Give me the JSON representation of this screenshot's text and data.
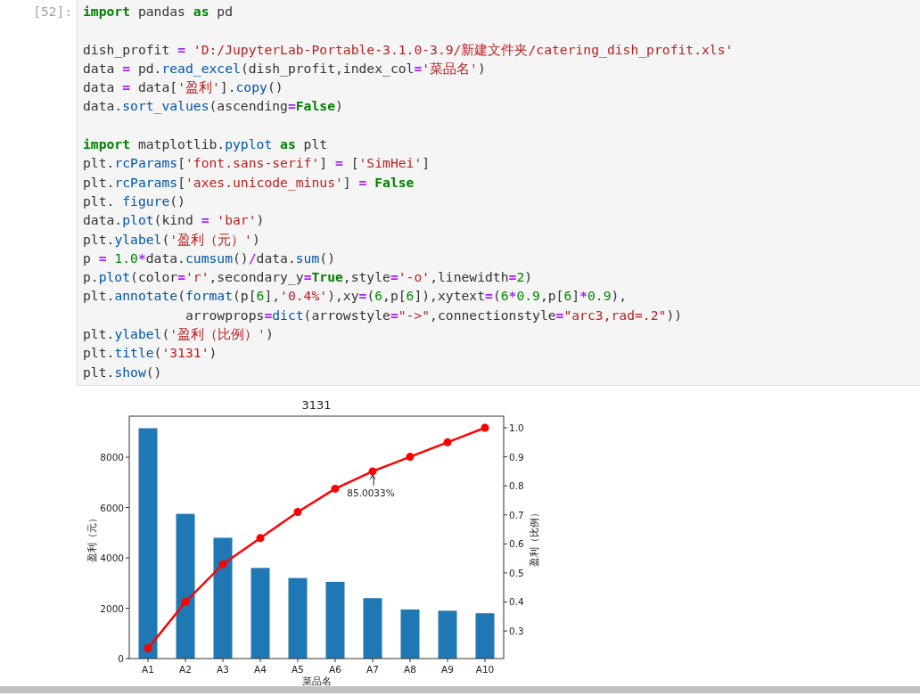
{
  "cell": {
    "prompt": "[52]:",
    "lines": [
      {
        "kind": "code",
        "tokens": [
          {
            "kind": "kw",
            "text": "import"
          },
          {
            "kind": "plain",
            "text": " pandas "
          },
          {
            "kind": "kw",
            "text": "as"
          },
          {
            "kind": "plain",
            "text": " pd"
          }
        ]
      },
      {
        "kind": "blank"
      },
      {
        "kind": "code",
        "tokens": [
          {
            "kind": "plain",
            "text": "dish_profit "
          },
          {
            "kind": "op",
            "text": "= "
          },
          {
            "kind": "str",
            "text": "'D:/JupyterLab-Portable-3.1.0-3.9/新建文件夹/catering_dish_profit.xls'"
          }
        ]
      },
      {
        "kind": "code",
        "tokens": [
          {
            "kind": "plain",
            "text": "data "
          },
          {
            "kind": "op",
            "text": "="
          },
          {
            "kind": "plain",
            "text": " pd."
          },
          {
            "kind": "fn",
            "text": "read_excel"
          },
          {
            "kind": "plain",
            "text": "(dish_profit,index_col"
          },
          {
            "kind": "op",
            "text": "="
          },
          {
            "kind": "str",
            "text": "'菜品名'"
          },
          {
            "kind": "plain",
            "text": ")"
          }
        ]
      },
      {
        "kind": "code",
        "tokens": [
          {
            "kind": "plain",
            "text": "data "
          },
          {
            "kind": "op",
            "text": "="
          },
          {
            "kind": "plain",
            "text": " data["
          },
          {
            "kind": "str",
            "text": "'盈利'"
          },
          {
            "kind": "plain",
            "text": "]."
          },
          {
            "kind": "fn",
            "text": "copy"
          },
          {
            "kind": "plain",
            "text": "()"
          }
        ]
      },
      {
        "kind": "code",
        "tokens": [
          {
            "kind": "plain",
            "text": "data."
          },
          {
            "kind": "fn",
            "text": "sort_values"
          },
          {
            "kind": "plain",
            "text": "(ascending"
          },
          {
            "kind": "op",
            "text": "="
          },
          {
            "kind": "kw",
            "text": "False"
          },
          {
            "kind": "plain",
            "text": ")"
          }
        ]
      },
      {
        "kind": "blank"
      },
      {
        "kind": "code",
        "tokens": [
          {
            "kind": "kw",
            "text": "import"
          },
          {
            "kind": "plain",
            "text": " matplotlib."
          },
          {
            "kind": "fn",
            "text": "pyplot"
          },
          {
            "kind": "kw",
            "text": " as"
          },
          {
            "kind": "plain",
            "text": " plt"
          }
        ]
      },
      {
        "kind": "code",
        "tokens": [
          {
            "kind": "plain",
            "text": "plt."
          },
          {
            "kind": "fn",
            "text": "rcParams"
          },
          {
            "kind": "plain",
            "text": "["
          },
          {
            "kind": "str",
            "text": "'font.sans-serif'"
          },
          {
            "kind": "plain",
            "text": "] "
          },
          {
            "kind": "op",
            "text": "="
          },
          {
            "kind": "plain",
            "text": " ["
          },
          {
            "kind": "str",
            "text": "'SimHei'"
          },
          {
            "kind": "plain",
            "text": "]"
          }
        ]
      },
      {
        "kind": "code",
        "tokens": [
          {
            "kind": "plain",
            "text": "plt."
          },
          {
            "kind": "fn",
            "text": "rcParams"
          },
          {
            "kind": "plain",
            "text": "["
          },
          {
            "kind": "str",
            "text": "'axes.unicode_minus'"
          },
          {
            "kind": "plain",
            "text": "] "
          },
          {
            "kind": "op",
            "text": "= "
          },
          {
            "kind": "kw",
            "text": "False"
          }
        ]
      },
      {
        "kind": "code",
        "tokens": [
          {
            "kind": "plain",
            "text": "plt. "
          },
          {
            "kind": "fn",
            "text": "figure"
          },
          {
            "kind": "plain",
            "text": "()"
          }
        ]
      },
      {
        "kind": "code",
        "tokens": [
          {
            "kind": "plain",
            "text": "data."
          },
          {
            "kind": "fn",
            "text": "plot"
          },
          {
            "kind": "plain",
            "text": "(kind "
          },
          {
            "kind": "op",
            "text": "= "
          },
          {
            "kind": "str",
            "text": "'bar'"
          },
          {
            "kind": "plain",
            "text": ")"
          }
        ]
      },
      {
        "kind": "code",
        "tokens": [
          {
            "kind": "plain",
            "text": "plt."
          },
          {
            "kind": "fn",
            "text": "ylabel"
          },
          {
            "kind": "plain",
            "text": "("
          },
          {
            "kind": "str",
            "text": "'盈利（元）'"
          },
          {
            "kind": "plain",
            "text": ")"
          }
        ]
      },
      {
        "kind": "code",
        "tokens": [
          {
            "kind": "plain",
            "text": "p "
          },
          {
            "kind": "op",
            "text": "= "
          },
          {
            "kind": "num",
            "text": "1.0"
          },
          {
            "kind": "op",
            "text": "*"
          },
          {
            "kind": "plain",
            "text": "data."
          },
          {
            "kind": "fn",
            "text": "cumsum"
          },
          {
            "kind": "plain",
            "text": "()"
          },
          {
            "kind": "op",
            "text": "/"
          },
          {
            "kind": "plain",
            "text": "data."
          },
          {
            "kind": "fn",
            "text": "sum"
          },
          {
            "kind": "plain",
            "text": "()"
          }
        ]
      },
      {
        "kind": "code",
        "tokens": [
          {
            "kind": "plain",
            "text": "p."
          },
          {
            "kind": "fn",
            "text": "plot"
          },
          {
            "kind": "plain",
            "text": "(color"
          },
          {
            "kind": "op",
            "text": "="
          },
          {
            "kind": "str",
            "text": "'r'"
          },
          {
            "kind": "plain",
            "text": ",secondary_y"
          },
          {
            "kind": "op",
            "text": "="
          },
          {
            "kind": "kw",
            "text": "True"
          },
          {
            "kind": "plain",
            "text": ",style"
          },
          {
            "kind": "op",
            "text": "="
          },
          {
            "kind": "str",
            "text": "'-o'"
          },
          {
            "kind": "plain",
            "text": ",linewidth"
          },
          {
            "kind": "op",
            "text": "="
          },
          {
            "kind": "num",
            "text": "2"
          },
          {
            "kind": "plain",
            "text": ")"
          }
        ]
      },
      {
        "kind": "code",
        "tokens": [
          {
            "kind": "plain",
            "text": "plt."
          },
          {
            "kind": "fn",
            "text": "annotate"
          },
          {
            "kind": "plain",
            "text": "("
          },
          {
            "kind": "fn",
            "text": "format"
          },
          {
            "kind": "plain",
            "text": "(p["
          },
          {
            "kind": "num",
            "text": "6"
          },
          {
            "kind": "plain",
            "text": "],"
          },
          {
            "kind": "str",
            "text": "'0.4%'"
          },
          {
            "kind": "plain",
            "text": "),xy"
          },
          {
            "kind": "op",
            "text": "="
          },
          {
            "kind": "plain",
            "text": "("
          },
          {
            "kind": "num",
            "text": "6"
          },
          {
            "kind": "plain",
            "text": ",p["
          },
          {
            "kind": "num",
            "text": "6"
          },
          {
            "kind": "plain",
            "text": "]),xytext"
          },
          {
            "kind": "op",
            "text": "="
          },
          {
            "kind": "plain",
            "text": "("
          },
          {
            "kind": "num",
            "text": "6"
          },
          {
            "kind": "op",
            "text": "*"
          },
          {
            "kind": "num",
            "text": "0.9"
          },
          {
            "kind": "plain",
            "text": ",p["
          },
          {
            "kind": "num",
            "text": "6"
          },
          {
            "kind": "plain",
            "text": "]"
          },
          {
            "kind": "op",
            "text": "*"
          },
          {
            "kind": "num",
            "text": "0.9"
          },
          {
            "kind": "plain",
            "text": "),"
          }
        ]
      },
      {
        "kind": "code",
        "tokens": [
          {
            "kind": "plain",
            "text": "             arrowprops"
          },
          {
            "kind": "op",
            "text": "="
          },
          {
            "kind": "fn",
            "text": "dict"
          },
          {
            "kind": "plain",
            "text": "(arrowstyle"
          },
          {
            "kind": "op",
            "text": "="
          },
          {
            "kind": "str",
            "text": "\"->\""
          },
          {
            "kind": "plain",
            "text": ",connectionstyle"
          },
          {
            "kind": "op",
            "text": "="
          },
          {
            "kind": "str",
            "text": "\"arc3,rad=.2\""
          },
          {
            "kind": "plain",
            "text": "))"
          }
        ]
      },
      {
        "kind": "code",
        "tokens": [
          {
            "kind": "plain",
            "text": "plt."
          },
          {
            "kind": "fn",
            "text": "ylabel"
          },
          {
            "kind": "plain",
            "text": "("
          },
          {
            "kind": "str",
            "text": "'盈利（比例）'"
          },
          {
            "kind": "plain",
            "text": ")"
          }
        ]
      },
      {
        "kind": "code",
        "tokens": [
          {
            "kind": "plain",
            "text": "plt."
          },
          {
            "kind": "fn",
            "text": "title"
          },
          {
            "kind": "plain",
            "text": "("
          },
          {
            "kind": "str",
            "text": "'3131'"
          },
          {
            "kind": "plain",
            "text": ")"
          }
        ]
      },
      {
        "kind": "code",
        "tokens": [
          {
            "kind": "plain",
            "text": "plt."
          },
          {
            "kind": "fn",
            "text": "show"
          },
          {
            "kind": "plain",
            "text": "()"
          }
        ]
      }
    ]
  },
  "output": {
    "charts": [
      {
        "chart_data": {
          "type": "bar",
          "title": "3131",
          "xlabel": "菜品名",
          "ylabel": "盈利（元）",
          "categories": [
            "A1",
            "A2",
            "A3",
            "A4",
            "A5",
            "A6",
            "A7",
            "A8",
            "A9",
            "A10"
          ],
          "series": [
            {
              "color": "#1f77b4",
              "values": [
                9150,
                5750,
                4800,
                3600,
                3200,
                3050,
                2400,
                1950,
                1900,
                1800
              ]
            }
          ],
          "ylim": [
            0,
            9630
          ],
          "yticks": [
            0,
            2000,
            4000,
            6000,
            8000
          ]
        }
      },
      {
        "chart_data": {
          "type": "line",
          "ylabel": "盈利（比例）",
          "categories": [
            null,
            null,
            null,
            null,
            null,
            null,
            null,
            null,
            null,
            null
          ],
          "series": [
            {
              "color": "#ff0000",
              "marker": "o",
              "values": [
                0.24,
                0.4,
                0.53,
                0.62,
                0.71,
                0.79,
                0.85,
                0.9,
                0.95,
                1.0
              ]
            }
          ],
          "ylim": [
            0.205,
            1.04
          ],
          "yticks": [
            {
              "value": 0.3,
              "label": "0.3"
            },
            {
              "value": 0.4,
              "label": "0.4"
            },
            {
              "value": 0.5,
              "label": "0.5"
            },
            {
              "value": 0.6,
              "label": "0.6"
            },
            {
              "value": 0.7,
              "label": "0.7"
            },
            {
              "value": 0.8,
              "label": "0.8"
            },
            {
              "value": 0.9,
              "label": "0.9"
            },
            {
              "value": 1.0,
              "label": "1.0"
            }
          ],
          "annotations": [
            {
              "text": "85.0033%",
              "y": 0.85
            }
          ]
        }
      }
    ]
  }
}
